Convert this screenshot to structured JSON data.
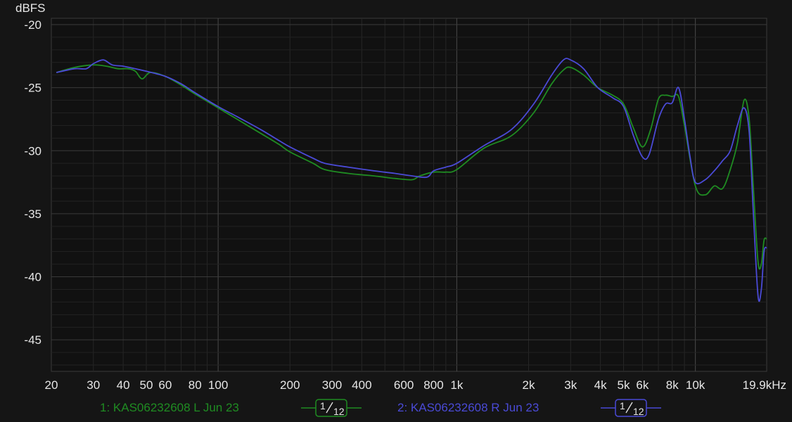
{
  "y_axis_title": "dBFS",
  "legend": [
    {
      "label": "1: KAS06232608 L Jun 23",
      "color": "#1f8c22",
      "smoothing_num": "1",
      "smoothing_den": "12"
    },
    {
      "label": "2: KAS06232608 R Jun 23",
      "color": "#4a4ad6",
      "smoothing_num": "1",
      "smoothing_den": "12"
    }
  ],
  "chart_data": {
    "type": "line",
    "xscale": "log",
    "xlim": [
      20,
      19900
    ],
    "ylim": [
      -47.5,
      -19.5
    ],
    "ylabel": "dBFS",
    "grid": true,
    "y_ticks": [
      -20,
      -25,
      -30,
      -35,
      -40,
      -45
    ],
    "x_ticks": [
      {
        "v": 20,
        "label": "20"
      },
      {
        "v": 30,
        "label": "30"
      },
      {
        "v": 40,
        "label": "40"
      },
      {
        "v": 50,
        "label": "50"
      },
      {
        "v": 60,
        "label": "60"
      },
      {
        "v": 80,
        "label": "80"
      },
      {
        "v": 100,
        "label": "100"
      },
      {
        "v": 200,
        "label": "200"
      },
      {
        "v": 300,
        "label": "300"
      },
      {
        "v": 400,
        "label": "400"
      },
      {
        "v": 600,
        "label": "600"
      },
      {
        "v": 800,
        "label": "800"
      },
      {
        "v": 1000,
        "label": "1k"
      },
      {
        "v": 2000,
        "label": "2k"
      },
      {
        "v": 3000,
        "label": "3k"
      },
      {
        "v": 4000,
        "label": "4k"
      },
      {
        "v": 5000,
        "label": "5k"
      },
      {
        "v": 6000,
        "label": "6k"
      },
      {
        "v": 8000,
        "label": "8k"
      },
      {
        "v": 10000,
        "label": "10k"
      },
      {
        "v": 19900,
        "label": "19.9kHz"
      }
    ],
    "series": [
      {
        "name": "1: KAS06232608 L Jun 23",
        "color": "#1f8c22",
        "x": [
          21,
          25,
          30,
          34,
          38,
          42,
          45,
          48,
          52,
          60,
          70,
          80,
          100,
          120,
          150,
          180,
          200,
          250,
          280,
          350,
          450,
          550,
          650,
          700,
          800,
          900,
          1000,
          1300,
          1700,
          2100,
          2500,
          2800,
          3000,
          3400,
          3900,
          4500,
          5000,
          5500,
          6000,
          6500,
          7000,
          7500,
          8000,
          8500,
          9000,
          10000,
          11000,
          12000,
          13000,
          14000,
          15000,
          16000,
          16800,
          17500,
          18300,
          18900,
          19400,
          19900
        ],
        "y": [
          -23.8,
          -23.4,
          -23.2,
          -23.3,
          -23.5,
          -23.5,
          -23.7,
          -24.3,
          -23.8,
          -24.1,
          -24.8,
          -25.5,
          -26.6,
          -27.5,
          -28.6,
          -29.5,
          -30.1,
          -31.0,
          -31.5,
          -31.8,
          -32.0,
          -32.2,
          -32.3,
          -32.0,
          -31.7,
          -31.7,
          -31.5,
          -29.8,
          -28.8,
          -27.0,
          -24.7,
          -23.6,
          -23.4,
          -24.0,
          -25.0,
          -25.6,
          -26.3,
          -28.2,
          -29.7,
          -28.3,
          -25.9,
          -25.6,
          -25.7,
          -25.7,
          -28.0,
          -32.8,
          -33.5,
          -32.8,
          -33.0,
          -31.5,
          -29.4,
          -26.0,
          -27.5,
          -33.0,
          -38.8,
          -39.0,
          -37.1,
          -37.0
        ]
      },
      {
        "name": "2: KAS06232608 R Jun 23",
        "color": "#4a4ad6",
        "x": [
          21,
          25,
          28,
          30,
          33,
          36,
          40,
          45,
          50,
          60,
          70,
          80,
          100,
          120,
          150,
          180,
          200,
          250,
          280,
          350,
          450,
          550,
          650,
          750,
          800,
          900,
          1000,
          1300,
          1700,
          2100,
          2500,
          2800,
          3000,
          3400,
          3900,
          4500,
          5000,
          5500,
          6000,
          6400,
          7000,
          7500,
          8000,
          8500,
          9000,
          9500,
          10000,
          11000,
          12000,
          13000,
          14000,
          15000,
          16000,
          16800,
          17500,
          18300,
          18900,
          19400,
          19900
        ],
        "y": [
          -23.8,
          -23.5,
          -23.5,
          -23.1,
          -22.8,
          -23.2,
          -23.3,
          -23.5,
          -23.7,
          -24.1,
          -24.7,
          -25.4,
          -26.5,
          -27.3,
          -28.3,
          -29.2,
          -29.7,
          -30.6,
          -31.0,
          -31.3,
          -31.6,
          -31.8,
          -32.0,
          -32.1,
          -31.6,
          -31.3,
          -31.0,
          -29.6,
          -28.3,
          -26.3,
          -24.0,
          -22.8,
          -22.8,
          -23.5,
          -25.0,
          -25.8,
          -26.5,
          -28.8,
          -30.5,
          -30.3,
          -27.5,
          -26.3,
          -26.2,
          -25.0,
          -27.5,
          -30.5,
          -32.5,
          -32.3,
          -31.6,
          -30.8,
          -30.0,
          -28.0,
          -26.6,
          -28.5,
          -35.0,
          -41.5,
          -41.0,
          -38.0,
          -37.7
        ]
      }
    ]
  }
}
